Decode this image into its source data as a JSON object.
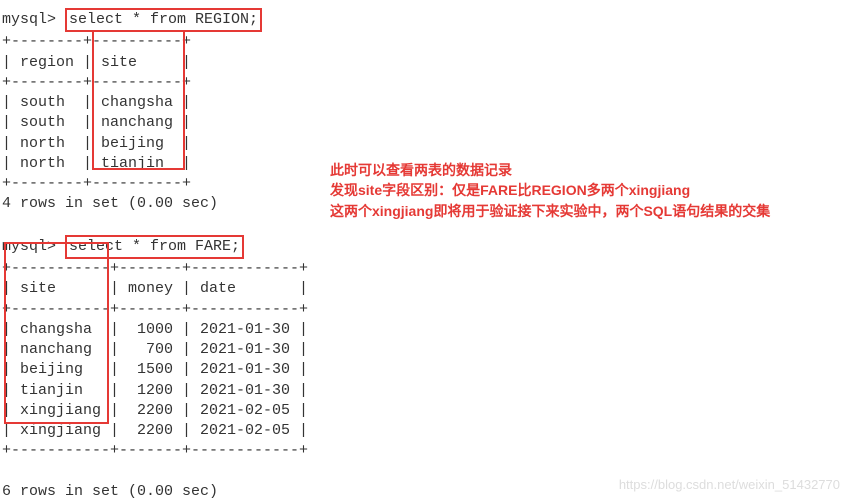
{
  "prompt1_prefix": "mysql>",
  "query1": "select * from REGION;",
  "region_border_top": "+--------+----------+",
  "region_header": "| region | site     |",
  "region_rows": [
    "| south  | changsha |",
    "| south  | nanchang |",
    "| north  | beijing  |",
    "| north  | tianjin  |"
  ],
  "region_footer": "4 rows in set (0.00 sec)",
  "prompt2_prefix": "mysql>",
  "query2": "select * from FARE;",
  "fare_border_top": "+-----------+-------+------------+",
  "fare_header": "| site      | money | date       |",
  "fare_rows": [
    "| changsha  |  1000 | 2021-01-30 |",
    "| nanchang  |   700 | 2021-01-30 |",
    "| beijing   |  1500 | 2021-01-30 |",
    "| tianjin   |  1200 | 2021-01-30 |",
    "| xingjiang |  2200 | 2021-02-05 |",
    "| xingjiang |  2200 | 2021-02-05 |"
  ],
  "fare_footer": "6 rows in set (0.00 sec)",
  "annotation": {
    "line1": "此时可以查看两表的数据记录",
    "line2": "发现site字段区别：仅是FARE比REGION多两个xingjiang",
    "line3": "这两个xingjiang即将用于验证接下来实验中，两个SQL语句结果的交集"
  },
  "watermark": "https://blog.csdn.net/weixin_51432770",
  "chart_data": {
    "type": "table",
    "tables": [
      {
        "name": "REGION",
        "columns": [
          "region",
          "site"
        ],
        "rows": [
          [
            "south",
            "changsha"
          ],
          [
            "south",
            "nanchang"
          ],
          [
            "north",
            "beijing"
          ],
          [
            "north",
            "tianjin"
          ]
        ]
      },
      {
        "name": "FARE",
        "columns": [
          "site",
          "money",
          "date"
        ],
        "rows": [
          [
            "changsha",
            1000,
            "2021-01-30"
          ],
          [
            "nanchang",
            700,
            "2021-01-30"
          ],
          [
            "beijing",
            1500,
            "2021-01-30"
          ],
          [
            "tianjin",
            1200,
            "2021-01-30"
          ],
          [
            "xingjiang",
            2200,
            "2021-02-05"
          ],
          [
            "xingjiang",
            2200,
            "2021-02-05"
          ]
        ]
      }
    ]
  }
}
